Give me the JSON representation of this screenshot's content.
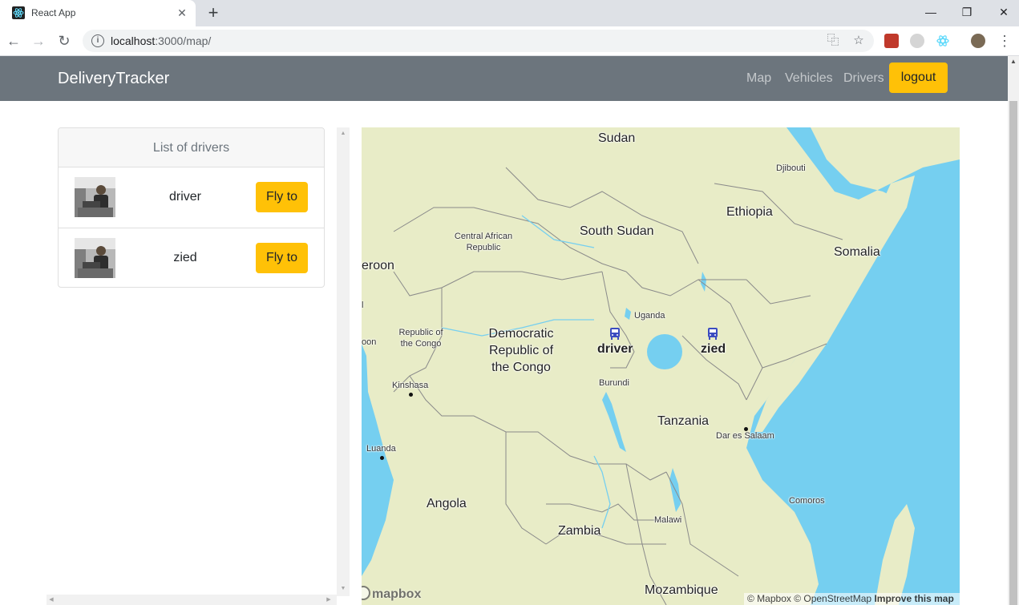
{
  "browser": {
    "tab_title": "React App",
    "url_host": "localhost",
    "url_path": ":3000/map/"
  },
  "navbar": {
    "brand": "DeliveryTracker",
    "links": [
      "Map",
      "Vehicles",
      "Drivers"
    ],
    "logout_label": "logout",
    "accent_color": "#ffc107",
    "bg_color": "#6c757d"
  },
  "drivers_panel": {
    "header": "List of drivers",
    "drivers": [
      {
        "name": "driver",
        "button_label": "Fly to"
      },
      {
        "name": "zied",
        "button_label": "Fly to"
      }
    ]
  },
  "map": {
    "countries": [
      "Sudan",
      "South Sudan",
      "Ethiopia",
      "Somalia",
      "Tanzania",
      "Angola",
      "Zambia",
      "Mozambique"
    ],
    "multi_line_labels": {
      "car": [
        "Central African",
        "Republic"
      ],
      "roc": [
        "Republic of",
        "the Congo"
      ],
      "drc": [
        "Democratic",
        "Republic of",
        "the Congo"
      ]
    },
    "small_labels": {
      "djibouti": "Djibouti",
      "uganda": "Uganda",
      "burundi": "Burundi",
      "malawi": "Malawi",
      "comoros": "Comoros",
      "cameroon": "eroon",
      "gabon": "oon",
      "eq": "l"
    },
    "cities": {
      "kinshasa": "Kinshasa",
      "luanda": "Luanda",
      "dar": "Dar es Salaam"
    },
    "markers": [
      "driver",
      "zied"
    ],
    "logo_text": "mapbox",
    "attribution": {
      "text": "© Mapbox © OpenStreetMap",
      "improve": "Improve this map"
    },
    "colors": {
      "land": "#e8ecc7",
      "water": "#75cff0",
      "border": "#8a8a8a",
      "marker": "#3b4cc0"
    }
  }
}
